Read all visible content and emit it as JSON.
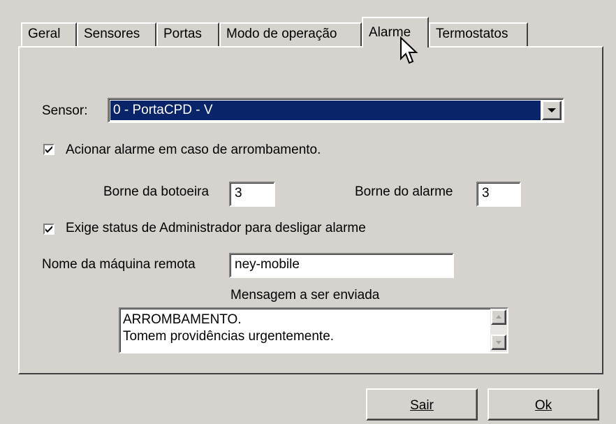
{
  "tabs": [
    {
      "label": "Geral",
      "active": false
    },
    {
      "label": "Sensores",
      "active": false
    },
    {
      "label": "Portas",
      "active": false
    },
    {
      "label": "Modo de operação",
      "active": false
    },
    {
      "label": "Alarme",
      "active": true
    },
    {
      "label": "Termostatos",
      "active": false
    }
  ],
  "sensor": {
    "label": "Sensor:",
    "selected": "0 - PortaCPD - V"
  },
  "acionar": {
    "checked": true,
    "label": "Acionar alarme em caso de arrombamento."
  },
  "borne_botoeira": {
    "label": "Borne da botoeira",
    "value": "3"
  },
  "borne_alarme": {
    "label": "Borne do alarme",
    "value": "3"
  },
  "exige": {
    "checked": true,
    "label": "Exige status de Administrador para desligar alarme"
  },
  "maquina_remota": {
    "label": "Nome da máquina remota",
    "value": "ney-mobile"
  },
  "mensagem": {
    "label": "Mensagem a ser enviada",
    "lines": [
      "ARROMBAMENTO.",
      "Tomem providências urgentemente."
    ]
  },
  "buttons": {
    "sair": "Sair",
    "ok": "Ok"
  },
  "colors": {
    "face": "#d6d3ce",
    "selection": "#0a246a"
  }
}
